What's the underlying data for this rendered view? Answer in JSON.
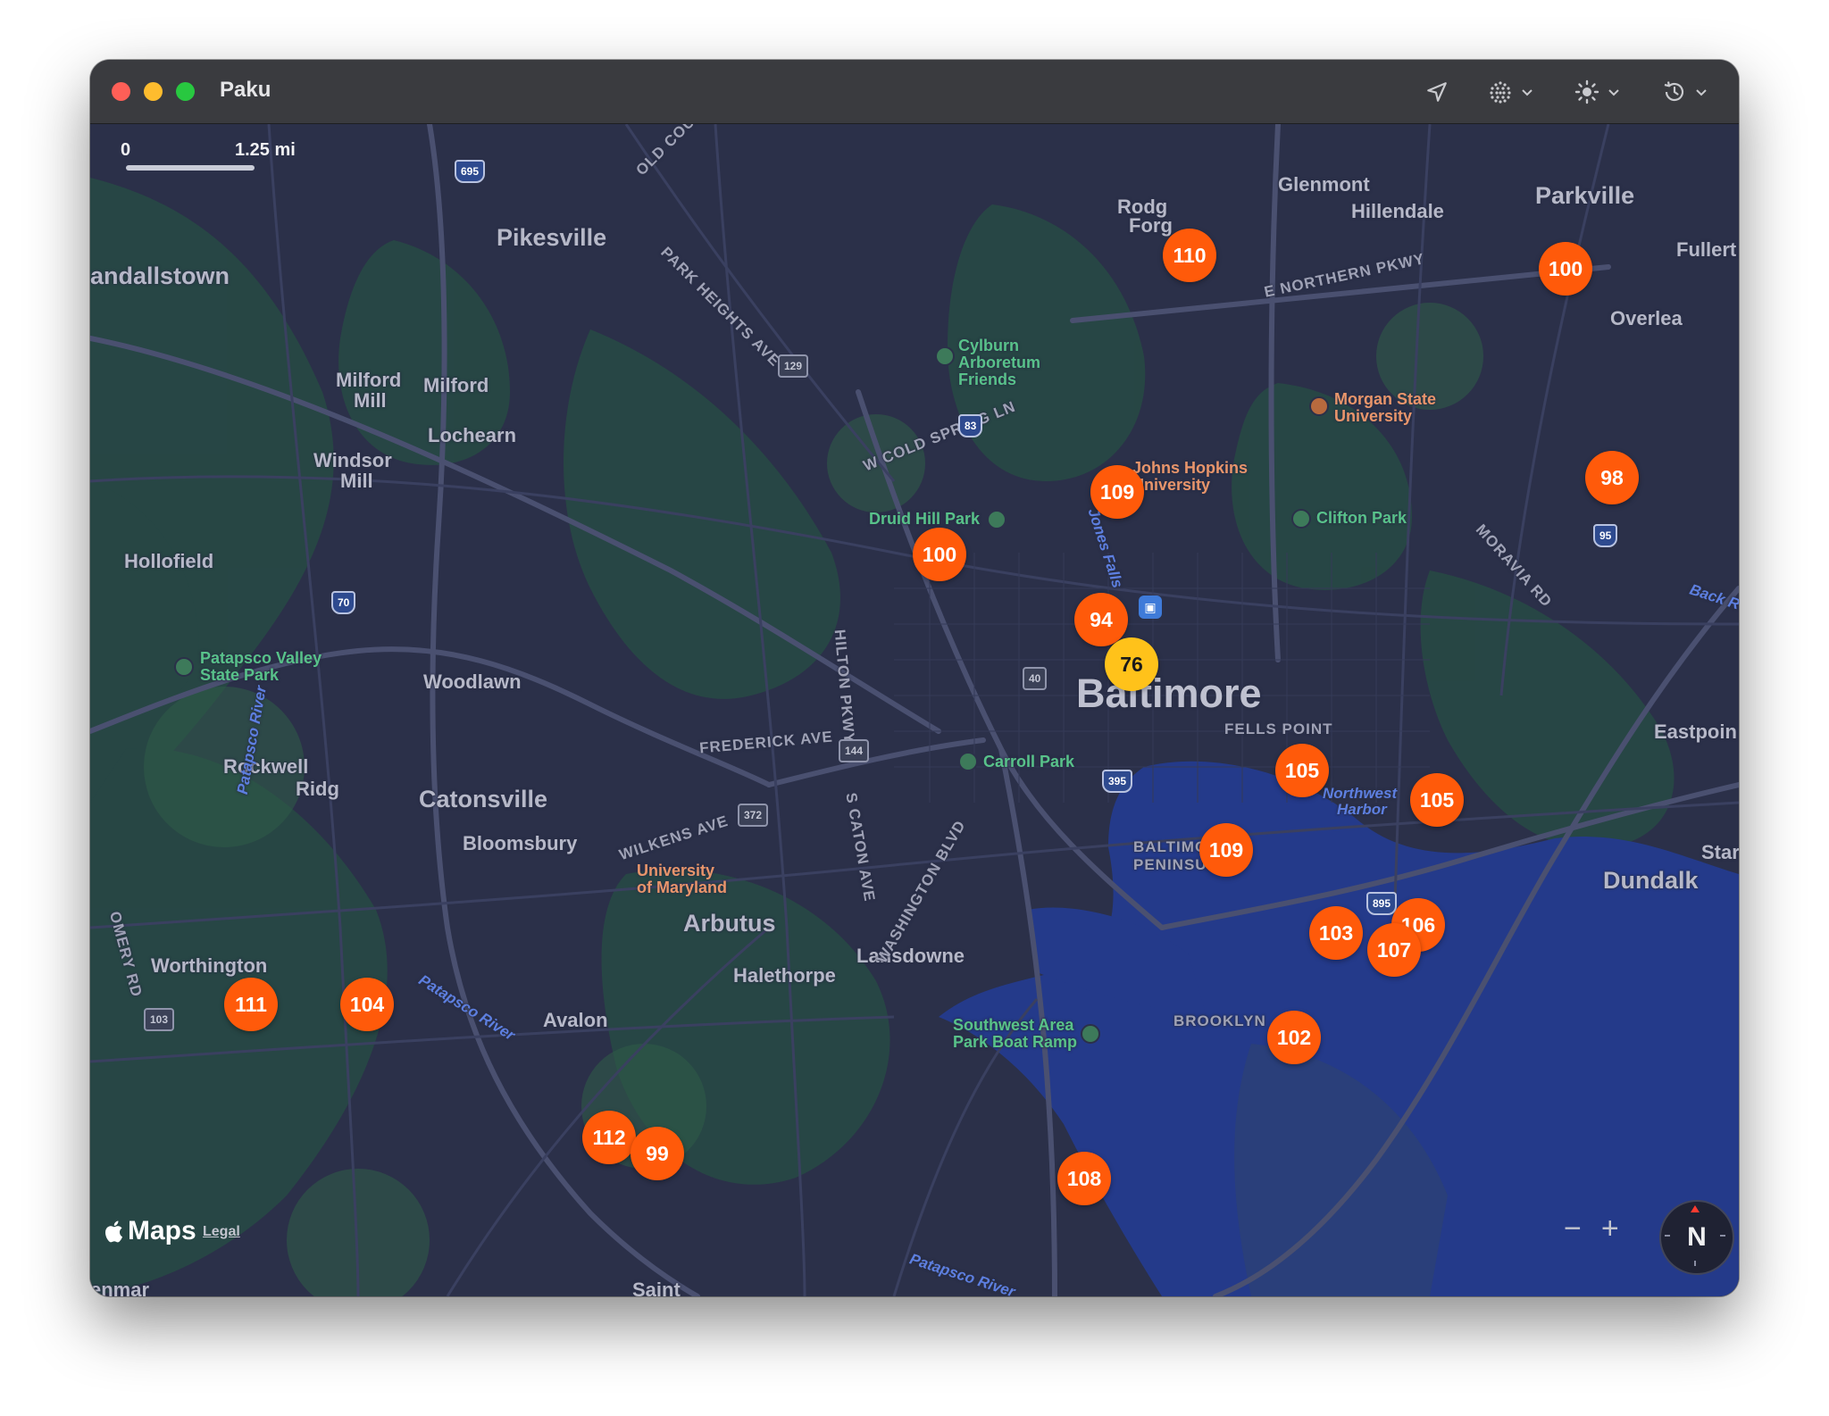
{
  "window": {
    "title": "Paku"
  },
  "toolbar": {
    "location_icon": "location-arrow-icon",
    "layers_icon": "grid-dots-icon",
    "theme_icon": "sun-icon",
    "history_icon": "clock-history-icon"
  },
  "scale": {
    "start": "0",
    "end": "1.25 mi"
  },
  "places": {
    "pikesville": "Pikesville",
    "randallstown": "andallstown",
    "milford_mill_1": "Milford",
    "milford_mill_1b": "Mill",
    "milford": "Milford",
    "lochearn": "Lochearn",
    "windsor_mill": "Windsor",
    "windsor_mill_b": "Mill",
    "hollofield": "Hollofield",
    "woodlawn": "Woodlawn",
    "catonsville": "Catonsville",
    "bloomsbury": "Bloomsbury",
    "rockwell": "Rockwell",
    "ridg": "Ridg",
    "worthington": "Worthington",
    "arbutus": "Arbutus",
    "halethorpe": "Halethorpe",
    "lansdowne": "Lansdowne",
    "avalon": "Avalon",
    "baltimore": "Baltimore",
    "fells_point": "FELLS POINT",
    "baltimore_peninsula": "BALTIMORE",
    "baltimore_peninsula_b": "PENINSULA",
    "brooklyn": "BROOKLYN",
    "glenmont": "Glenmont",
    "hillendale": "Hillendale",
    "parkville": "Parkville",
    "fullerton": "Fullert",
    "overlea": "Overlea",
    "eastpoint": "Eastpoin",
    "dundalk": "Dundalk",
    "star": "Star",
    "rodgers_forge": "Rodg",
    "rodgers_forge_b": "Forg",
    "denmar": "enmar",
    "saint": "Saint"
  },
  "roads": {
    "old_court": "OLD COUR",
    "park_heights": "PARK HEIGHTS AVE",
    "cold_spring": "W COLD SPRING LN",
    "northern_pkwy": "E NORTHERN PKWY",
    "moravia": "MORAVIA RD",
    "hilton": "HILTON PKWY",
    "frederick": "FREDERICK AVE",
    "caton": "S CATON AVE",
    "washington": "WASHINGTON BLVD",
    "wilkens": "WILKENS AVE",
    "montgomery": "OMERY RD"
  },
  "pois": {
    "cylburn": [
      "Cylburn",
      "Arboretum",
      "Friends"
    ],
    "morgan": [
      "Morgan State",
      "University"
    ],
    "jhu": [
      "Johns Hopkins",
      "University"
    ],
    "druid": "Druid Hill Park",
    "clifton": "Clifton Park",
    "patapsco_valley": [
      "Patapsco Valley",
      "State Park"
    ],
    "carroll": "Carroll Park",
    "umbc": [
      "University",
      "of Maryland"
    ],
    "southwest": [
      "Southwest Area",
      "Park Boat Ramp"
    ]
  },
  "water": {
    "jones_falls": "Jones Falls",
    "patapsco_river_1": "Patapsco River",
    "patapsco_river_2": "Patapsco River",
    "patapsco_river_3": "Patapsco River",
    "northwest_harbor": [
      "Northwest",
      "Harbor"
    ],
    "back_river": "Back R"
  },
  "shields": [
    "695",
    "129",
    "83",
    "70",
    "40",
    "144",
    "395",
    "372",
    "895",
    "95",
    "103"
  ],
  "markers": [
    {
      "value": "110",
      "color": "orange"
    },
    {
      "value": "100",
      "color": "orange"
    },
    {
      "value": "109",
      "color": "orange"
    },
    {
      "value": "98",
      "color": "orange"
    },
    {
      "value": "100",
      "color": "orange"
    },
    {
      "value": "94",
      "color": "orange"
    },
    {
      "value": "76",
      "color": "yellow"
    },
    {
      "value": "105",
      "color": "orange"
    },
    {
      "value": "105",
      "color": "orange"
    },
    {
      "value": "109",
      "color": "orange"
    },
    {
      "value": "106",
      "color": "orange"
    },
    {
      "value": "103",
      "color": "orange"
    },
    {
      "value": "107",
      "color": "orange"
    },
    {
      "value": "102",
      "color": "orange"
    },
    {
      "value": "111",
      "color": "orange"
    },
    {
      "value": "104",
      "color": "orange"
    },
    {
      "value": "112",
      "color": "orange"
    },
    {
      "value": "99",
      "color": "orange"
    },
    {
      "value": "108",
      "color": "orange"
    }
  ],
  "attribution": {
    "brand": "Maps",
    "legal": "Legal"
  },
  "controls": {
    "zoom_out": "−",
    "zoom_in": "+",
    "compass": "N"
  },
  "colors": {
    "marker": "#ff5a0a",
    "marker_warn": "#ffc21a",
    "water": "#243a8a",
    "land": "#2b3049"
  }
}
